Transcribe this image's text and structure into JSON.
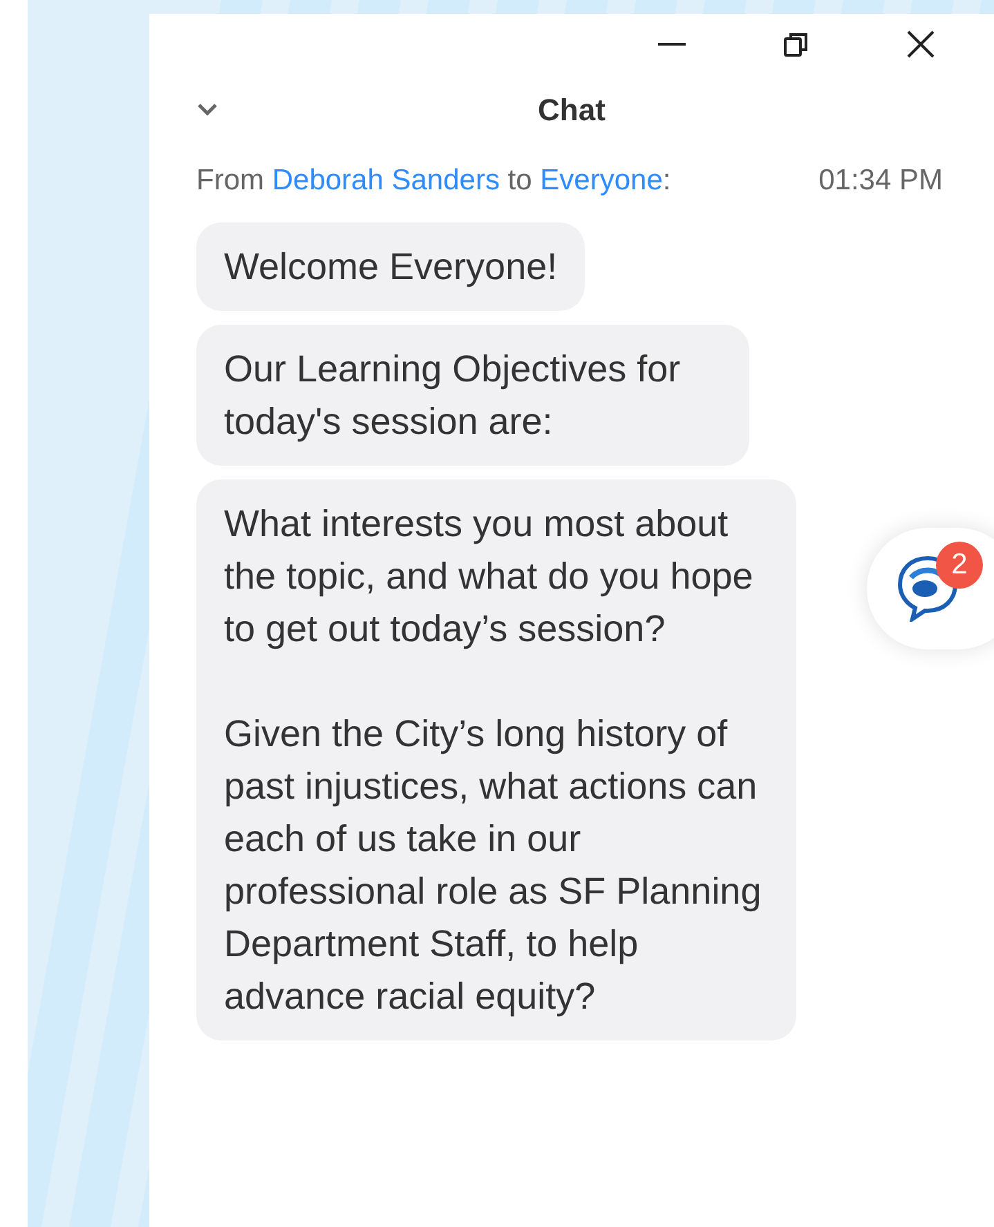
{
  "window": {
    "title": "Chat"
  },
  "header": {
    "from_label": "From",
    "sender": "Deborah Sanders",
    "to_label": "to",
    "recipient": "Everyone",
    "suffix": ":",
    "time": "01:34 PM"
  },
  "messages": [
    {
      "paragraphs": [
        "Welcome Everyone!"
      ]
    },
    {
      "paragraphs": [
        "Our Learning Objectives for today's session are:"
      ]
    },
    {
      "paragraphs": [
        "What interests you most about the topic, and what do you hope to get out today’s session?",
        "Given the City’s long history of past injustices, what actions can each of us take in our professional role as SF Planning Department Staff, to help advance racial equity?"
      ]
    }
  ],
  "chat_widget": {
    "badge": "2"
  }
}
